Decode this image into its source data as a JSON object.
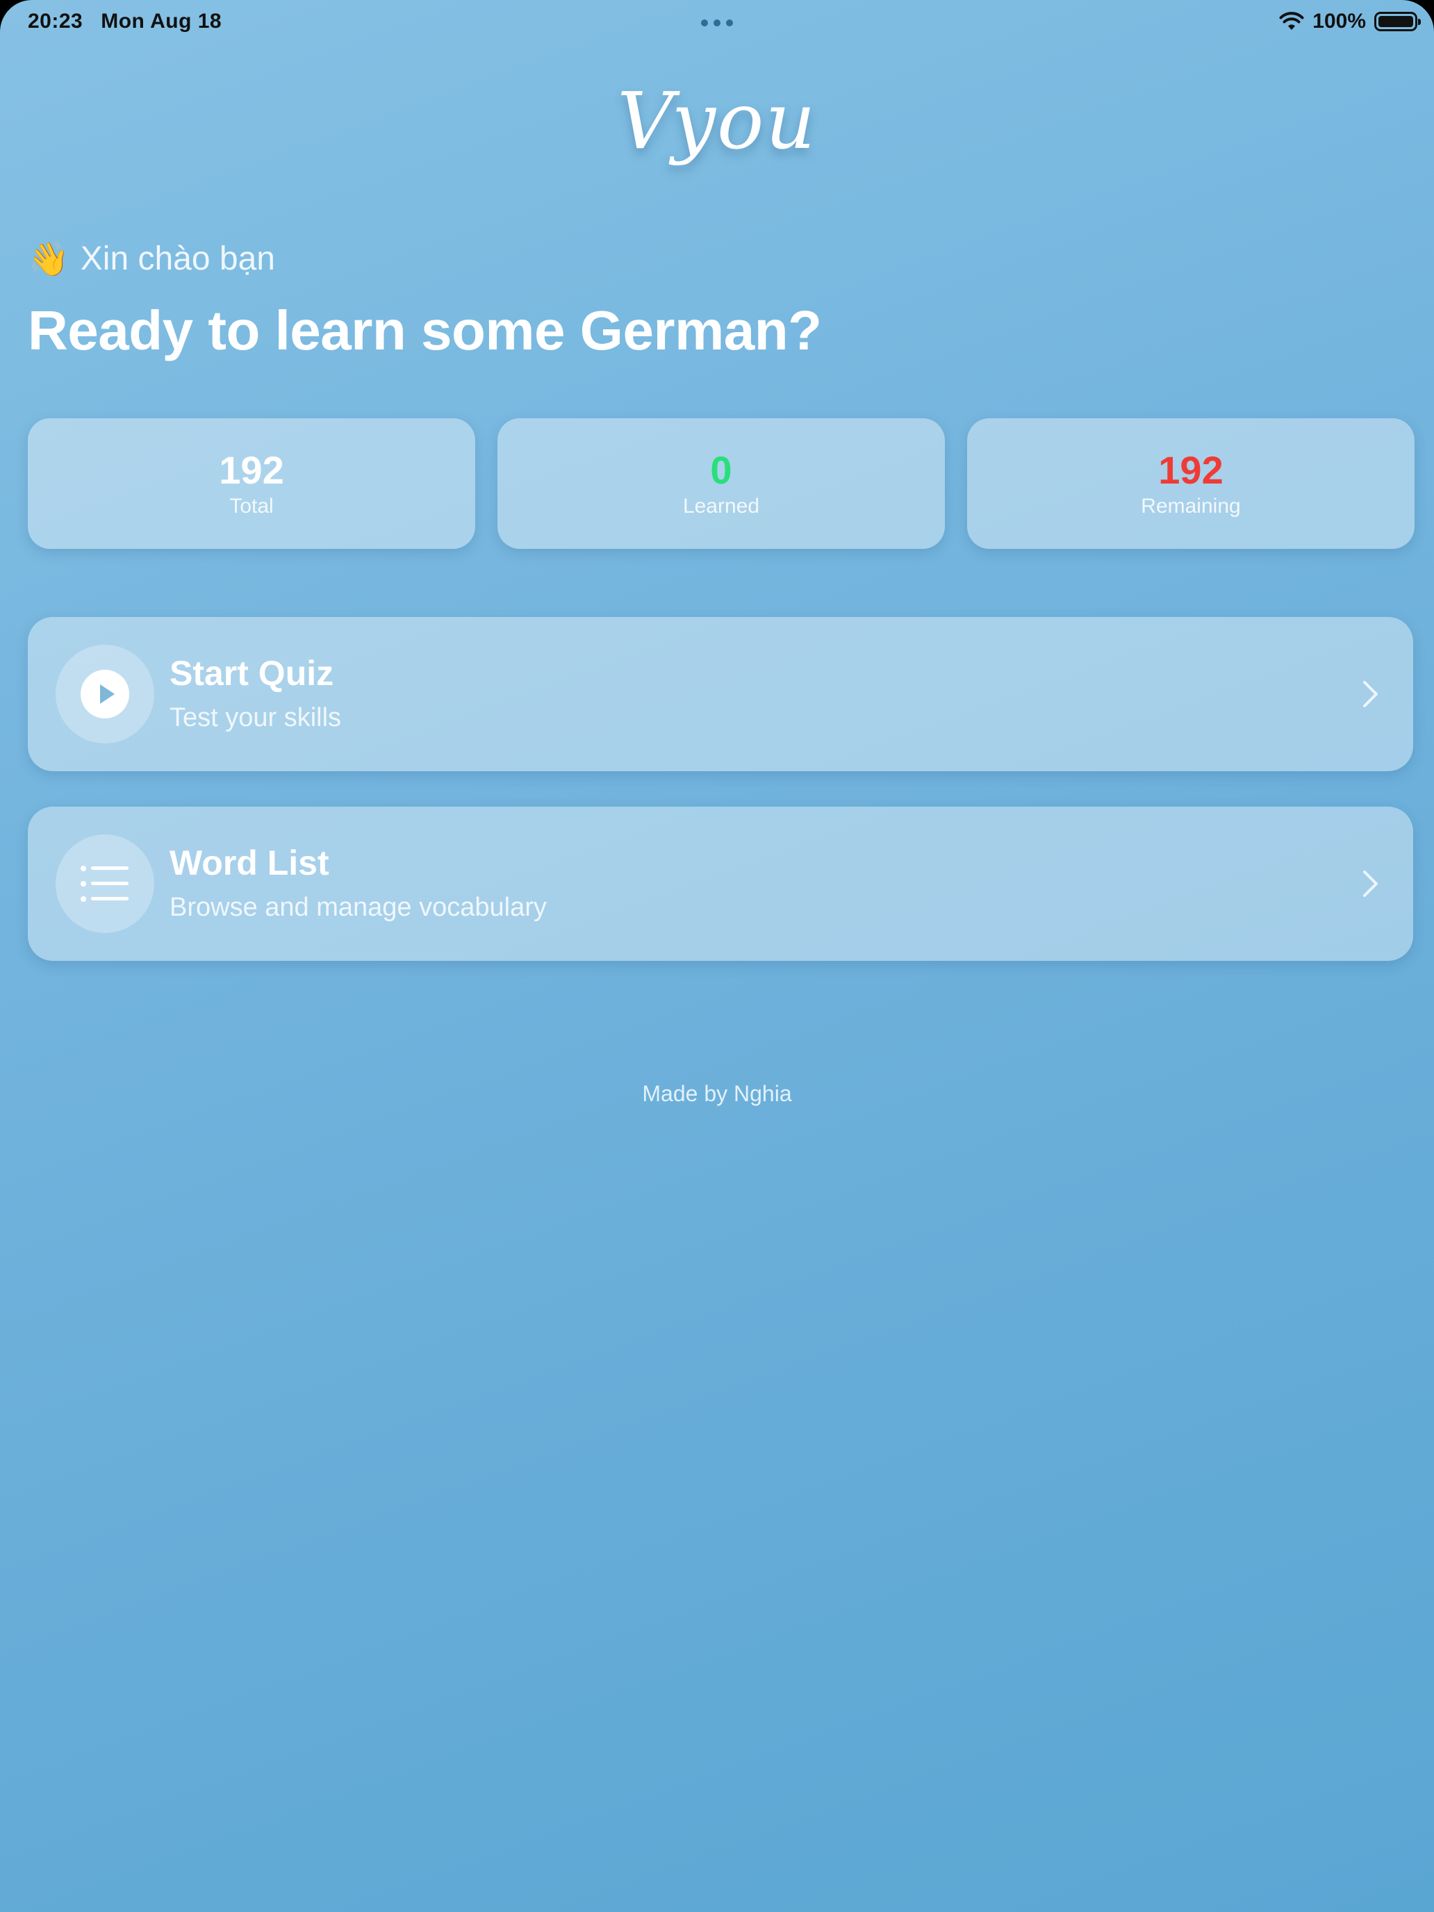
{
  "status_bar": {
    "time": "20:23",
    "date": "Mon Aug 18",
    "battery": "100%"
  },
  "app": {
    "logo": "Vyou"
  },
  "greeting": {
    "icon": "waving-hand-icon",
    "text": "Xin chào bạn",
    "headline": "Ready to learn some German?"
  },
  "stats": [
    {
      "value": "192",
      "label": "Total",
      "color": "#ffffff"
    },
    {
      "value": "0",
      "label": "Learned",
      "color": "#27e07a"
    },
    {
      "value": "192",
      "label": "Remaining",
      "color": "#ef3b36"
    }
  ],
  "actions": {
    "quiz": {
      "title": "Start Quiz",
      "subtitle": "Test your skills",
      "icon": "play-icon"
    },
    "words": {
      "title": "Word List",
      "subtitle": "Browse and manage vocabulary",
      "icon": "list-icon"
    }
  },
  "footer": "Made by Nghia"
}
